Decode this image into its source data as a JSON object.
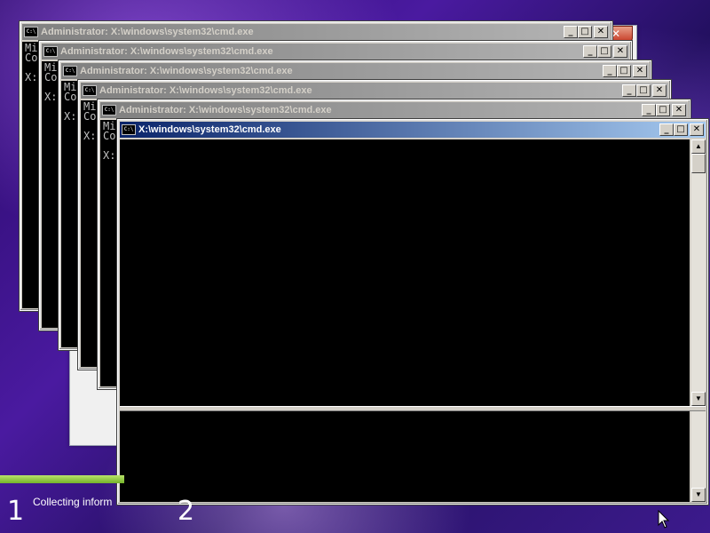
{
  "setup": {
    "status_text": "Collecting inform",
    "step1": "1",
    "step2": "2"
  },
  "consoles": [
    {
      "title": "Administrator: X:\\windows\\system32\\cmd.exe",
      "lines": [
        "Mi",
        "Co",
        "",
        "X:"
      ]
    },
    {
      "title": "Administrator: X:\\windows\\system32\\cmd.exe",
      "lines": [
        "Mi",
        "Co",
        "",
        "X:"
      ]
    },
    {
      "title": "Administrator: X:\\windows\\system32\\cmd.exe",
      "lines": [
        "Mi",
        "Co",
        "",
        "X:"
      ]
    },
    {
      "title": "Administrator: X:\\windows\\system32\\cmd.exe",
      "lines": [
        "Mi",
        "Co",
        "",
        "X:"
      ]
    },
    {
      "title": "Administrator: X:\\windows\\system32\\cmd.exe",
      "lines": [
        "Mi",
        "Co",
        "",
        "X:"
      ]
    }
  ],
  "active_console": {
    "title": "X:\\windows\\system32\\cmd.exe"
  },
  "icons": {
    "cmd": "cmd-icon",
    "minimize": "minimize-icon",
    "maximize": "maximize-icon",
    "close": "close-icon"
  },
  "glyphs": {
    "cmd_icon": "C:\\",
    "minimize": "_",
    "maximize": "□",
    "close": "✕",
    "scroll_up": "▲",
    "scroll_down": "▼"
  }
}
